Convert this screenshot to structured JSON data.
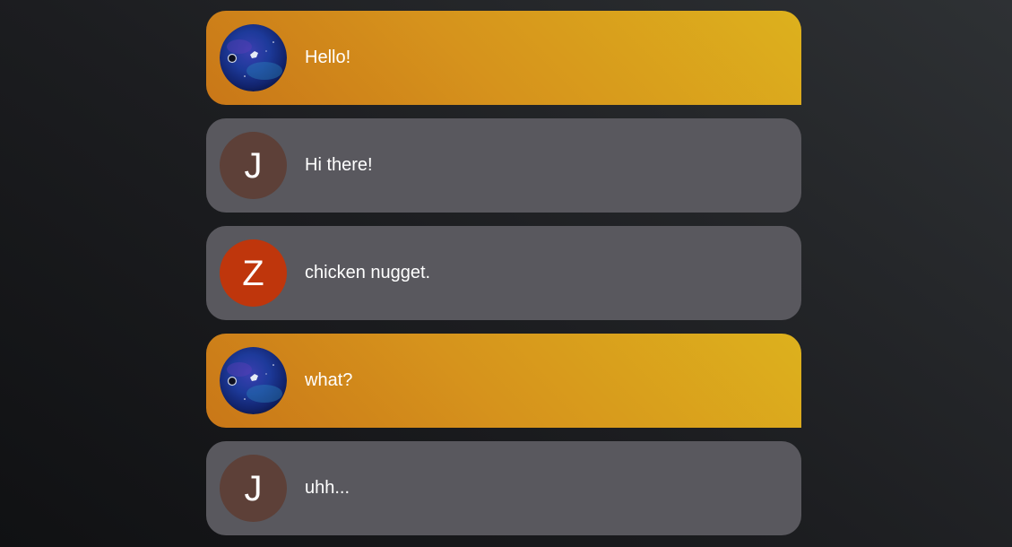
{
  "colors": {
    "self_gradient_start": "#c97718",
    "self_gradient_end": "#ddb11d",
    "other_bubble": "#59585e",
    "avatar_j": "#5d4038",
    "avatar_z": "#bf360c"
  },
  "messages": [
    {
      "sender": "self",
      "avatar_icon": "space-avatar-icon",
      "text": "Hello!"
    },
    {
      "sender": "other",
      "avatar_initial": "J",
      "avatar_color": "#5d4038",
      "text": "Hi there!"
    },
    {
      "sender": "other",
      "avatar_initial": "Z",
      "avatar_color": "#bf360c",
      "text": "chicken nugget."
    },
    {
      "sender": "self",
      "avatar_icon": "space-avatar-icon",
      "text": "what?"
    },
    {
      "sender": "other",
      "avatar_initial": "J",
      "avatar_color": "#5d4038",
      "text": "uhh..."
    }
  ]
}
